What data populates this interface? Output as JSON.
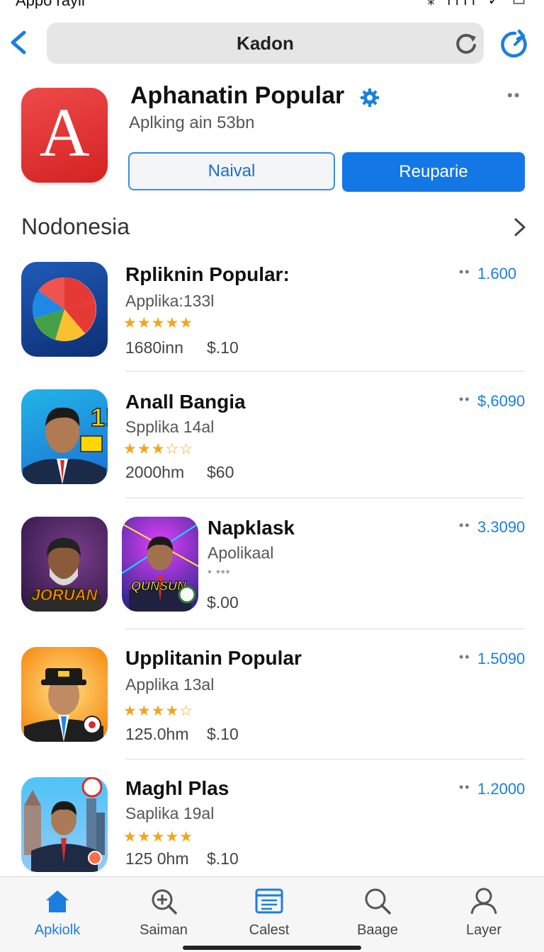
{
  "status": {
    "time": "Appo rayii",
    "icons": "⁎ ıııı ✓ ▭"
  },
  "nav": {
    "title": "Kadon"
  },
  "hero": {
    "letter": "A",
    "title": "Aphanatin Popular",
    "subtitle": "Aplking ain 53bn",
    "more": "••",
    "button_outline": "Naival",
    "button_primary": "Reuparie"
  },
  "section": {
    "title": "Nodonesia"
  },
  "apps": [
    {
      "name": "Rpliknin Popular:",
      "sub": "Applika:133l",
      "stars": "★★★★★",
      "rating": 5,
      "meta": "1680inn",
      "price": "$.10",
      "value": "1.600"
    },
    {
      "name": "Anall Bangia",
      "sub": "Spplika 14al",
      "stars": "★★★☆☆",
      "rating": 3.5,
      "meta": "2000hm",
      "price": "$60",
      "value": "$,6090"
    },
    {
      "name": "Napklask",
      "sub": "Apolikaal",
      "stars": "* ***",
      "meta": "",
      "price": "$.00",
      "value": "3.3090",
      "icon1_text": "JORUAN",
      "icon2_text": "QUNSUN"
    },
    {
      "name": "Upplitanin Popular",
      "sub": "Applika 13al",
      "stars": "★★★★☆",
      "rating": 4.5,
      "meta": "125.0hm",
      "price": "$.10",
      "value": "1.5090"
    },
    {
      "name": "Maghl Plas",
      "sub": "Saplika 19al",
      "stars": "★★★★★",
      "rating": 5,
      "meta": "125 0hm",
      "price": "$.10",
      "value": "1.2000"
    }
  ],
  "tabs": [
    {
      "label": "Apkiolk",
      "icon": "home-icon",
      "active": true
    },
    {
      "label": "Saiman",
      "icon": "search-plus-icon"
    },
    {
      "label": "Calest",
      "icon": "list-icon"
    },
    {
      "label": "Baage",
      "icon": "search-icon"
    },
    {
      "label": "Layer",
      "icon": "person-icon"
    }
  ],
  "colors": {
    "accent": "#1477e6",
    "star": "#f3a51b",
    "hero_icon": "#e23030"
  }
}
